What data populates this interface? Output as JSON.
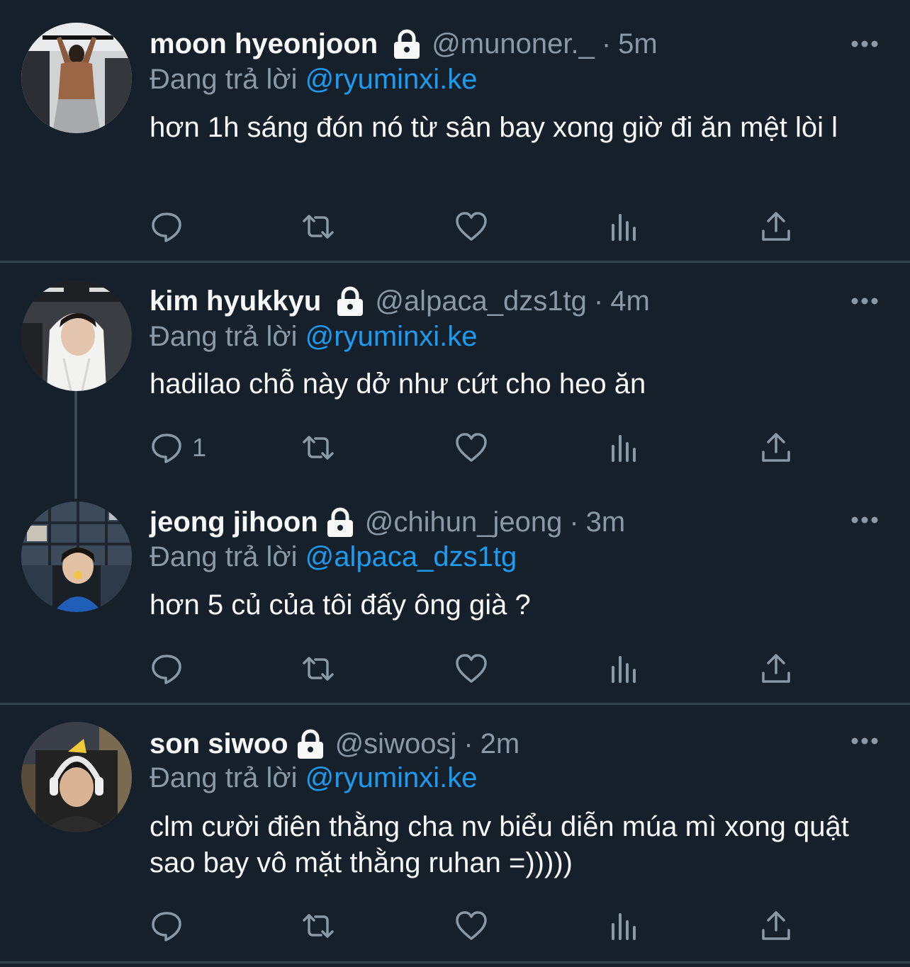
{
  "colors": {
    "background": "#15202b",
    "text_primary": "#f7f9f9",
    "text_secondary": "#8b98a5",
    "link": "#1d9bf0",
    "divider": "#38444d"
  },
  "tweets": [
    {
      "name": "moon hyeonjoon",
      "handle": "@munoner._",
      "time": "5m",
      "replying_prefix": "Đang trả lời",
      "replying_to": "@ryuminxi.ke",
      "text": "hơn 1h sáng đón nó từ sân bay xong giờ đi ăn mệt lòi l",
      "reply_count": "",
      "avatar": "gym-photo-avatar"
    },
    {
      "name": "kim hyukkyu",
      "handle": "@alpaca_dzs1tg",
      "time": "4m",
      "replying_prefix": "Đang trả lời",
      "replying_to": "@ryuminxi.ke",
      "text": "hadilao chỗ này dở như cứt cho heo ăn",
      "reply_count": "1",
      "avatar": "white-hoodie-avatar"
    },
    {
      "name": "jeong jihoon",
      "handle": "@chihun_jeong",
      "time": "3m",
      "replying_prefix": "Đang trả lời",
      "replying_to": "@alpaca_dzs1tg",
      "text": "hơn 5 củ của tôi đấy ông già ?",
      "reply_count": "",
      "avatar": "bookshelf-room-avatar"
    },
    {
      "name": "son siwoo",
      "handle": "@siwoosj",
      "time": "2m",
      "replying_prefix": "Đang trả lời",
      "replying_to": "@ryuminxi.ke",
      "text": "clm cười điên thằng cha nv biểu diễn múa mì xong quật sao bay vô mặt thằng ruhan =)))))",
      "reply_count": "",
      "avatar": "headset-gamer-avatar"
    }
  ],
  "icons": {
    "lock": "lock-icon",
    "more": "more-icon",
    "reply": "reply-icon",
    "retweet": "retweet-icon",
    "like": "like-icon",
    "views": "views-icon",
    "share": "share-icon"
  },
  "separator": "·"
}
